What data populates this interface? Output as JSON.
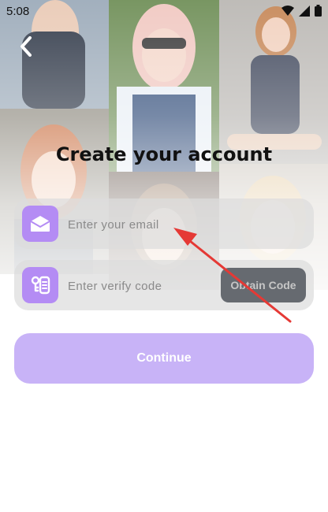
{
  "status_bar": {
    "time": "5:08"
  },
  "header": {
    "title": "Create your account"
  },
  "form": {
    "email_placeholder": "Enter your email",
    "code_placeholder": "Enter verify code",
    "obtain_code_label": "Obtain Code",
    "continue_label": "Continue"
  },
  "icons": {
    "back": "back-chevron-icon",
    "email": "envelope-icon",
    "code": "verify-code-icon",
    "wifi": "wifi-icon",
    "signal": "signal-icon",
    "battery": "battery-icon"
  },
  "colors": {
    "accent": "#b48cf4",
    "button_disabled": "#c8b3f7",
    "obtain_button": "#666a70",
    "annotation_arrow": "#e53935"
  }
}
